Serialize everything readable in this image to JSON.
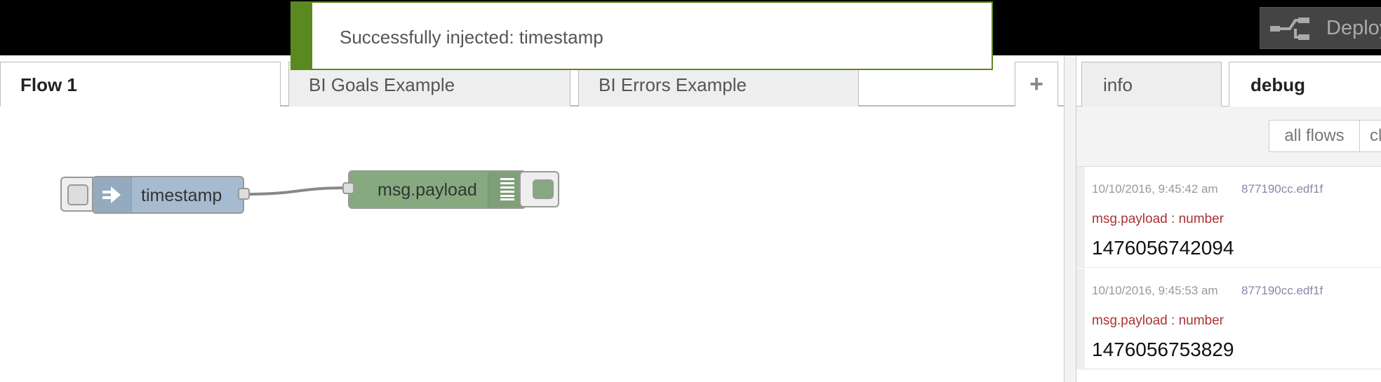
{
  "header": {
    "deploy_label": "Deploy"
  },
  "notification": {
    "message": "Successfully injected: timestamp"
  },
  "workspace": {
    "tabs": [
      {
        "label": "Flow 1"
      },
      {
        "label": "BI Goals Example"
      },
      {
        "label": "BI Errors Example"
      }
    ],
    "add_tab_label": "+"
  },
  "nodes": {
    "inject": {
      "label": "timestamp",
      "color": "#a6bbcf"
    },
    "debug": {
      "label": "msg.payload",
      "color": "#87a980"
    }
  },
  "sidebar": {
    "tabs": [
      {
        "label": "info"
      },
      {
        "label": "debug"
      }
    ],
    "filter_label": "all flows",
    "clear_label": "clear",
    "messages": [
      {
        "time": "10/10/2016, 9:45:42 am",
        "node_id": "877190cc.edf1f",
        "type": "msg.payload : number",
        "value": "1476056742094"
      },
      {
        "time": "10/10/2016, 9:45:53 am",
        "node_id": "877190cc.edf1f",
        "type": "msg.payload : number",
        "value": "1476056753829"
      }
    ]
  },
  "colors": {
    "success": "#5a8a1f",
    "header_bg": "#000000",
    "msg_type": "#aa3333"
  }
}
